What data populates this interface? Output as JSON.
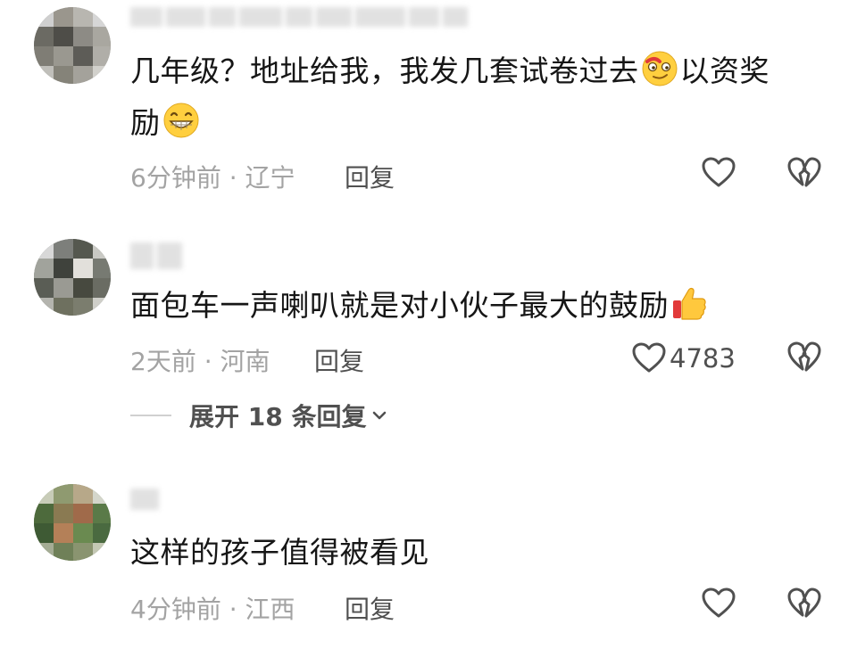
{
  "comments": [
    {
      "username": "",
      "text_line1": "几年级？地址给我，我发几套试卷过去",
      "text_line1_after": "以资奖",
      "text_line2": "励",
      "time_location": "6分钟前 · 辽宁",
      "reply_label": "回复",
      "like_count": "",
      "emojis": [
        "smirk-face-emoji",
        "grinning-face-emoji"
      ]
    },
    {
      "username": "",
      "text_line1": "面包车一声喇叭就是对小伙子最大的鼓励",
      "time_location": "2天前 · 河南",
      "reply_label": "回复",
      "like_count": "4783",
      "emojis": [
        "thumbs-up-emoji"
      ],
      "expand_replies_label": "展开 18 条回复"
    },
    {
      "username": "",
      "text_line1": "这样的孩子值得被看见",
      "time_location": "4分钟前 · 江西",
      "reply_label": "回复",
      "like_count": ""
    }
  ],
  "icons": {
    "like": "heart-outline-icon",
    "dislike": "broken-heart-outline-icon",
    "expand": "chevron-down-icon"
  },
  "colors": {
    "text_primary": "#161616",
    "text_secondary": "#a3a3a3",
    "text_action": "#505050",
    "icon": "#505050",
    "background": "#ffffff"
  }
}
